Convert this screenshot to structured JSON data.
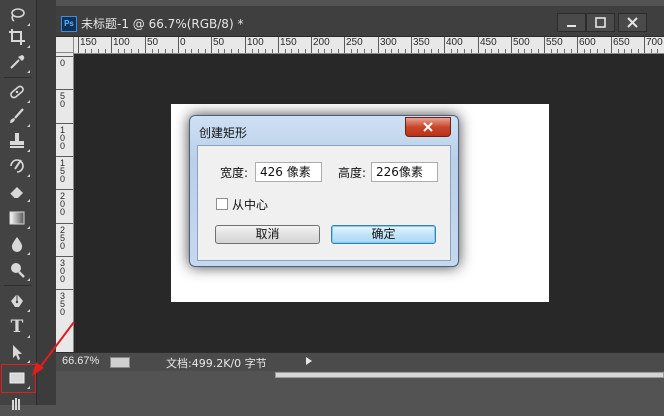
{
  "document": {
    "ps_badge": "Ps",
    "title": "未标题-1 @ 66.7%(RGB/8) *"
  },
  "rulers": {
    "horizontal": [
      "150",
      "100",
      "50",
      "0",
      "50",
      "100",
      "150",
      "200",
      "250",
      "300",
      "350",
      "400",
      "450",
      "500",
      "550",
      "600",
      "650",
      "700"
    ],
    "vertical": [
      "0",
      "50",
      "100",
      "150",
      "200",
      "250",
      "300",
      "350"
    ]
  },
  "status": {
    "zoom": "66.67%",
    "doc_info": "文档:499.2K/0 字节"
  },
  "dialog": {
    "title": "创建矩形",
    "width_label": "宽度:",
    "width_value": "426 像素",
    "height_label": "高度:",
    "height_value": "226像素",
    "from_center_label": "从中心",
    "from_center_checked": false,
    "cancel_label": "取消",
    "ok_label": "确定"
  },
  "colors": {
    "highlight": "#e01e1e",
    "toolbar_bg": "#434343",
    "canvas_bg": "#ffffff"
  },
  "toolbar": {
    "tools": [
      "brush-icon",
      "crop-icon",
      "eyedropper-icon",
      "healing-brush-icon",
      "brush-tool-icon",
      "stamp-icon",
      "history-brush-icon",
      "eraser-icon",
      "gradient-icon",
      "blur-icon",
      "dodge-icon",
      "pen-icon",
      "type-icon",
      "path-select-icon",
      "rectangle-icon",
      "hand-icon"
    ],
    "type_tool_glyph": "T"
  }
}
